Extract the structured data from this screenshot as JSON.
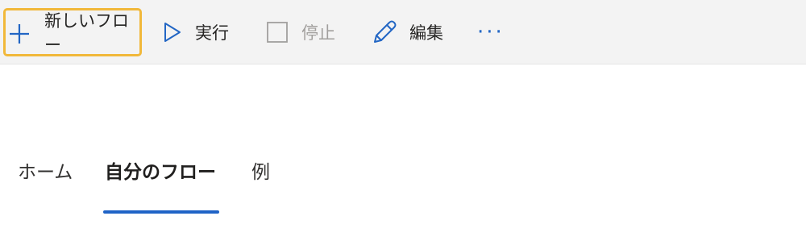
{
  "toolbar": {
    "new_flow_label": "新しいフロー",
    "run_label": "実行",
    "stop_label": "停止",
    "edit_label": "編集",
    "more_label": "···",
    "icons": {
      "new_flow": "plus-icon",
      "run": "play-icon",
      "stop": "stop-icon",
      "edit": "pencil-icon",
      "more": "ellipsis-icon"
    },
    "accent_color": "#2266c4",
    "highlight_color": "#f1b83a"
  },
  "tabs": {
    "items": [
      {
        "label": "ホーム",
        "selected": false
      },
      {
        "label": "自分のフロー",
        "selected": true
      },
      {
        "label": "例",
        "selected": false
      }
    ],
    "underline_color": "#1f63c6"
  }
}
